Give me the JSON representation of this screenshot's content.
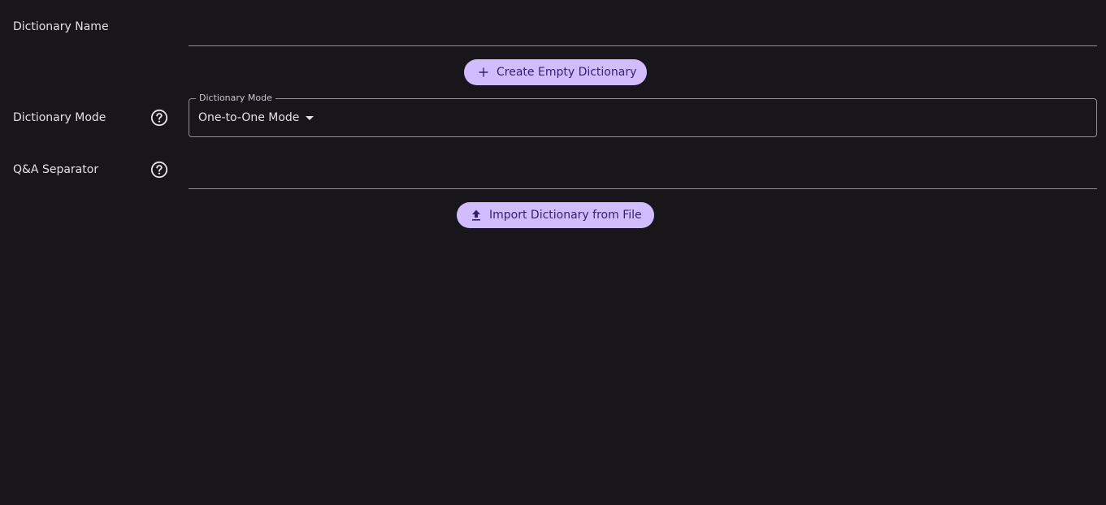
{
  "form": {
    "dictionary_name": {
      "label": "Dictionary Name",
      "value": "",
      "placeholder": ""
    },
    "create_button": {
      "icon": "plus-icon",
      "label": "Create Empty Dictionary"
    },
    "dictionary_mode": {
      "label": "Dictionary Mode",
      "help_icon": "help-circle-icon",
      "select_label": "Dictionary Mode",
      "selected_value": "One-to-One Mode"
    },
    "qa_separator": {
      "label": "Q&A Separator",
      "help_icon": "help-circle-icon",
      "value": "",
      "placeholder": ""
    },
    "import_button": {
      "icon": "upload-icon",
      "label": "Import Dictionary from File"
    }
  },
  "colors": {
    "background": "#18161b",
    "text": "#e6e1e5",
    "button_bg": "#d0bcff",
    "button_text": "#381e72",
    "outline": "#938f99"
  }
}
